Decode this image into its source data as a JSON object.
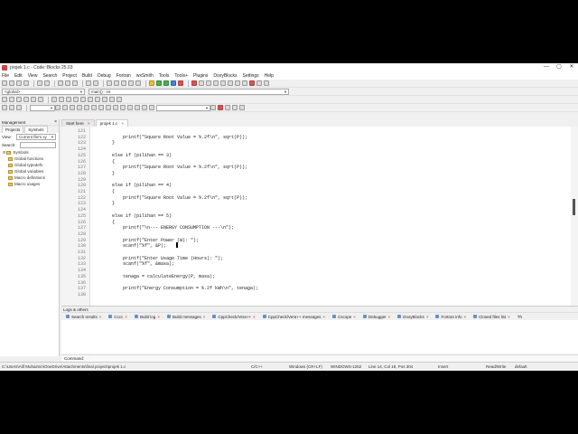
{
  "window": {
    "title": "projek 1.c - Code::Blocks 25.03",
    "controls": [
      "—",
      "▢",
      "✕"
    ]
  },
  "menu": [
    "File",
    "Edit",
    "View",
    "Search",
    "Project",
    "Build",
    "Debug",
    "Fortran",
    "wxSmith",
    "Tools",
    "Tools+",
    "Plugins",
    "DoxyBlocks",
    "Settings",
    "Help"
  ],
  "toolbar": {
    "scope_combo": "<global>",
    "function_combo": "main() : int"
  },
  "management": {
    "title": "Management",
    "tabs": [
      "Projects",
      "Symbols"
    ],
    "active_tab": "Symbols",
    "view_label": "View:",
    "view_value": "Current file's sy",
    "search_label": "Search:",
    "tree_root": "Symbols",
    "tree_items": [
      "Global functions",
      "Global typedefs",
      "Global variables",
      "Macro definitions",
      "Macro usages"
    ]
  },
  "editor_tabs": [
    "Start here",
    "projek 1.c"
  ],
  "active_editor_tab": "projek 1.c",
  "editor": {
    "lines": [
      {
        "n": "121",
        "t": ""
      },
      {
        "n": "122",
        "t": "        printf(\"Square Root Value = %.2f\\n\", sqrt(P));"
      },
      {
        "n": "123",
        "t": "    }"
      },
      {
        "n": "124",
        "t": ""
      },
      {
        "n": "125",
        "t": "    else if (pilihan == 3)"
      },
      {
        "n": "126",
        "t": "    {"
      },
      {
        "n": "127",
        "t": "        printf(\"Square Root Value = %.2f\\n\", sqrt(P));"
      },
      {
        "n": "128",
        "t": "    }"
      },
      {
        "n": "129",
        "t": ""
      },
      {
        "n": "120",
        "t": "    else if (pilihan == 4)"
      },
      {
        "n": "121",
        "t": "    {"
      },
      {
        "n": "122",
        "t": "        printf(\"Square Root Value = %.2f\\n\", sqrt(P));"
      },
      {
        "n": "123",
        "t": "    }"
      },
      {
        "n": "124",
        "t": ""
      },
      {
        "n": "125",
        "t": "    else if (pilihan == 5)"
      },
      {
        "n": "126",
        "t": "    {"
      },
      {
        "n": "127",
        "t": "        printf(\"\\n--- ENERGY CONSUMPTION ---\\n\");"
      },
      {
        "n": "128",
        "t": ""
      },
      {
        "n": "129",
        "t": "        printf(\"Enter Power (W): \");"
      },
      {
        "n": "130",
        "t": "        scanf(\"%f\", &P);"
      },
      {
        "n": "131",
        "t": ""
      },
      {
        "n": "132",
        "t": "        printf(\"Enter Usage Time (Hours): \");"
      },
      {
        "n": "133",
        "t": "        scanf(\"%f\", &masa);"
      },
      {
        "n": "134",
        "t": ""
      },
      {
        "n": "135",
        "t": "        tenaga = calculateEnergy(P, masa);"
      },
      {
        "n": "136",
        "t": ""
      },
      {
        "n": "137",
        "t": "        printf(\"Energy Consumption = %.2f kWh\\n\", tenaga);"
      },
      {
        "n": "138",
        "t": ""
      }
    ]
  },
  "logs": {
    "title": "Logs & others",
    "tabs": [
      "Search results",
      "Cccc",
      "Build log",
      "Build messages",
      "CppCheck/Vera++",
      "CppCheck/Vera++ messages",
      "Cscope",
      "Debugger",
      "DoxyBlocks",
      "Fortran info",
      "Closed files list",
      "Th"
    ],
    "command_label": "Command:"
  },
  "status": {
    "path": "C:\\Users\\Alif Muhaimin\\OneDrive\\Attachments\\final project\\projek 1.c",
    "language": "C/C++",
    "eol": "Windows (CR+LF)",
    "encoding": "WINDOWS-1252",
    "position": "Line 14, Col 19, Pos 304",
    "mode": "Insert",
    "access": "Read/Write",
    "profile": "default"
  }
}
